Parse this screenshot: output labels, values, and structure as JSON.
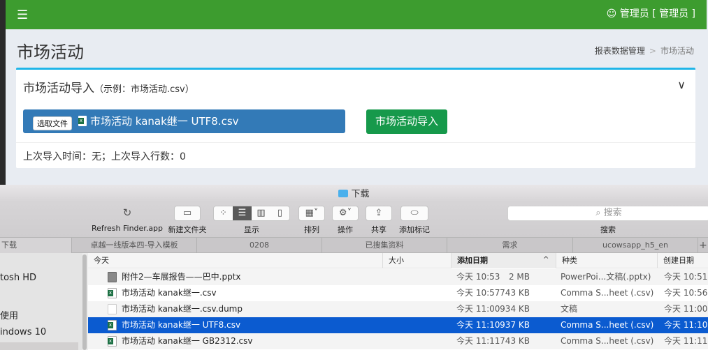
{
  "header": {
    "menu_icon": "hamburger-icon",
    "user": "管理员 [ 管理员 ]",
    "user_icon": "user-circle-icon",
    "color": "#3d9c2f"
  },
  "page": {
    "title": "市场活动",
    "breadcrumb": [
      "报表数据管理",
      "市场活动"
    ],
    "breadcrumb_sep": ">"
  },
  "card": {
    "title": "市场活动导入",
    "hint": "（示例：市场活动.csv）",
    "choose_label": "选取文件",
    "file_name": "市场活动 kanak继一 UTF8.csv",
    "import_label": "市场活动导入",
    "last_import": "上次导入时间：无；上次导入行数：0"
  },
  "finder": {
    "title": "下载",
    "toolbar": {
      "refresh": "Refresh Finder.app",
      "new_folder": "新建文件夹",
      "view": "显示",
      "arrange": "排列",
      "action": "操作",
      "share": "共享",
      "tags": "添加标记",
      "search_placeholder": "搜索",
      "search": "搜索"
    },
    "tabs": [
      "下载",
      "卓越一线版本四-导入模板",
      "0208",
      "已搜集资料",
      "需求",
      "ucowsapp_h5_en",
      "+"
    ],
    "sidebar": [
      "tosh HD",
      "使用",
      "indows 10"
    ],
    "columns": [
      "今天",
      "大小",
      "添加日期",
      "种类",
      "创建日期"
    ],
    "sort_indicator": "^",
    "files": [
      {
        "name": "附件2—车展报告——巴中.pptx",
        "size": "2 MB",
        "added": "今天 10:53",
        "kind": "PowerPoi...文稿(.pptx)",
        "created": "今天 10:51",
        "icon": "ppt"
      },
      {
        "name": "市场活动 kanak继一.csv",
        "size": "743 KB",
        "added": "今天 10:57",
        "kind": "Comma S...heet (.csv)",
        "created": "今天 10:56",
        "icon": "csv"
      },
      {
        "name": "市场活动 kanak继一.csv.dump",
        "size": "934 KB",
        "added": "今天 11:00",
        "kind": "文稿",
        "created": "今天 11:00",
        "icon": "doc"
      },
      {
        "name": "市场活动 kanak继一 UTF8.csv",
        "size": "937 KB",
        "added": "今天 11:10",
        "kind": "Comma S...heet (.csv)",
        "created": "今天 11:10",
        "icon": "csv",
        "selected": true
      },
      {
        "name": "市场活动 kanak继一 GB2312.csv",
        "size": "743 KB",
        "added": "今天 11:11",
        "kind": "Comma S...heet (.csv)",
        "created": "今天 11:11",
        "icon": "csv"
      }
    ]
  }
}
